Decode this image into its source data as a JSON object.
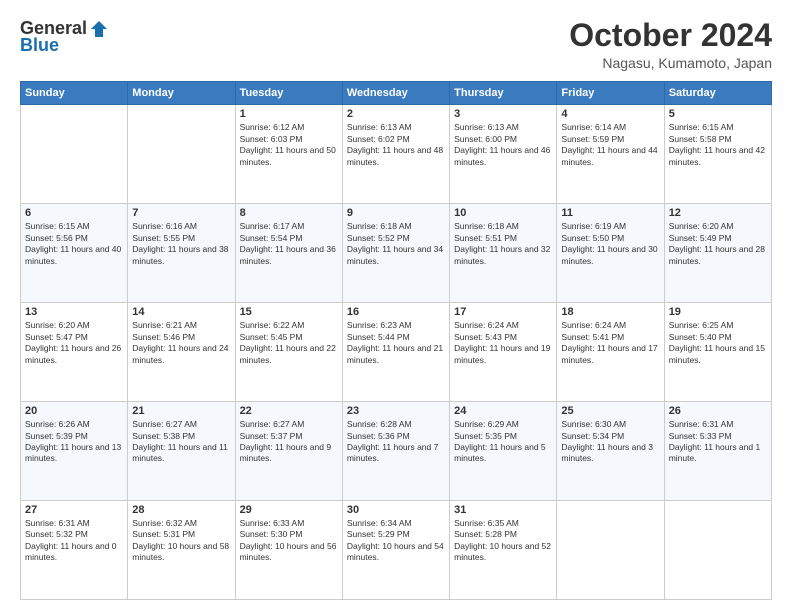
{
  "header": {
    "logo": {
      "general": "General",
      "blue": "Blue"
    },
    "title": "October 2024",
    "location": "Nagasu, Kumamoto, Japan"
  },
  "days_of_week": [
    "Sunday",
    "Monday",
    "Tuesday",
    "Wednesday",
    "Thursday",
    "Friday",
    "Saturday"
  ],
  "weeks": [
    [
      {
        "day": "",
        "info": ""
      },
      {
        "day": "",
        "info": ""
      },
      {
        "day": "1",
        "info": "Sunrise: 6:12 AM\nSunset: 6:03 PM\nDaylight: 11 hours and 50 minutes."
      },
      {
        "day": "2",
        "info": "Sunrise: 6:13 AM\nSunset: 6:02 PM\nDaylight: 11 hours and 48 minutes."
      },
      {
        "day": "3",
        "info": "Sunrise: 6:13 AM\nSunset: 6:00 PM\nDaylight: 11 hours and 46 minutes."
      },
      {
        "day": "4",
        "info": "Sunrise: 6:14 AM\nSunset: 5:59 PM\nDaylight: 11 hours and 44 minutes."
      },
      {
        "day": "5",
        "info": "Sunrise: 6:15 AM\nSunset: 5:58 PM\nDaylight: 11 hours and 42 minutes."
      }
    ],
    [
      {
        "day": "6",
        "info": "Sunrise: 6:15 AM\nSunset: 5:56 PM\nDaylight: 11 hours and 40 minutes."
      },
      {
        "day": "7",
        "info": "Sunrise: 6:16 AM\nSunset: 5:55 PM\nDaylight: 11 hours and 38 minutes."
      },
      {
        "day": "8",
        "info": "Sunrise: 6:17 AM\nSunset: 5:54 PM\nDaylight: 11 hours and 36 minutes."
      },
      {
        "day": "9",
        "info": "Sunrise: 6:18 AM\nSunset: 5:52 PM\nDaylight: 11 hours and 34 minutes."
      },
      {
        "day": "10",
        "info": "Sunrise: 6:18 AM\nSunset: 5:51 PM\nDaylight: 11 hours and 32 minutes."
      },
      {
        "day": "11",
        "info": "Sunrise: 6:19 AM\nSunset: 5:50 PM\nDaylight: 11 hours and 30 minutes."
      },
      {
        "day": "12",
        "info": "Sunrise: 6:20 AM\nSunset: 5:49 PM\nDaylight: 11 hours and 28 minutes."
      }
    ],
    [
      {
        "day": "13",
        "info": "Sunrise: 6:20 AM\nSunset: 5:47 PM\nDaylight: 11 hours and 26 minutes."
      },
      {
        "day": "14",
        "info": "Sunrise: 6:21 AM\nSunset: 5:46 PM\nDaylight: 11 hours and 24 minutes."
      },
      {
        "day": "15",
        "info": "Sunrise: 6:22 AM\nSunset: 5:45 PM\nDaylight: 11 hours and 22 minutes."
      },
      {
        "day": "16",
        "info": "Sunrise: 6:23 AM\nSunset: 5:44 PM\nDaylight: 11 hours and 21 minutes."
      },
      {
        "day": "17",
        "info": "Sunrise: 6:24 AM\nSunset: 5:43 PM\nDaylight: 11 hours and 19 minutes."
      },
      {
        "day": "18",
        "info": "Sunrise: 6:24 AM\nSunset: 5:41 PM\nDaylight: 11 hours and 17 minutes."
      },
      {
        "day": "19",
        "info": "Sunrise: 6:25 AM\nSunset: 5:40 PM\nDaylight: 11 hours and 15 minutes."
      }
    ],
    [
      {
        "day": "20",
        "info": "Sunrise: 6:26 AM\nSunset: 5:39 PM\nDaylight: 11 hours and 13 minutes."
      },
      {
        "day": "21",
        "info": "Sunrise: 6:27 AM\nSunset: 5:38 PM\nDaylight: 11 hours and 11 minutes."
      },
      {
        "day": "22",
        "info": "Sunrise: 6:27 AM\nSunset: 5:37 PM\nDaylight: 11 hours and 9 minutes."
      },
      {
        "day": "23",
        "info": "Sunrise: 6:28 AM\nSunset: 5:36 PM\nDaylight: 11 hours and 7 minutes."
      },
      {
        "day": "24",
        "info": "Sunrise: 6:29 AM\nSunset: 5:35 PM\nDaylight: 11 hours and 5 minutes."
      },
      {
        "day": "25",
        "info": "Sunrise: 6:30 AM\nSunset: 5:34 PM\nDaylight: 11 hours and 3 minutes."
      },
      {
        "day": "26",
        "info": "Sunrise: 6:31 AM\nSunset: 5:33 PM\nDaylight: 11 hours and 1 minute."
      }
    ],
    [
      {
        "day": "27",
        "info": "Sunrise: 6:31 AM\nSunset: 5:32 PM\nDaylight: 11 hours and 0 minutes."
      },
      {
        "day": "28",
        "info": "Sunrise: 6:32 AM\nSunset: 5:31 PM\nDaylight: 10 hours and 58 minutes."
      },
      {
        "day": "29",
        "info": "Sunrise: 6:33 AM\nSunset: 5:30 PM\nDaylight: 10 hours and 56 minutes."
      },
      {
        "day": "30",
        "info": "Sunrise: 6:34 AM\nSunset: 5:29 PM\nDaylight: 10 hours and 54 minutes."
      },
      {
        "day": "31",
        "info": "Sunrise: 6:35 AM\nSunset: 5:28 PM\nDaylight: 10 hours and 52 minutes."
      },
      {
        "day": "",
        "info": ""
      },
      {
        "day": "",
        "info": ""
      }
    ]
  ]
}
